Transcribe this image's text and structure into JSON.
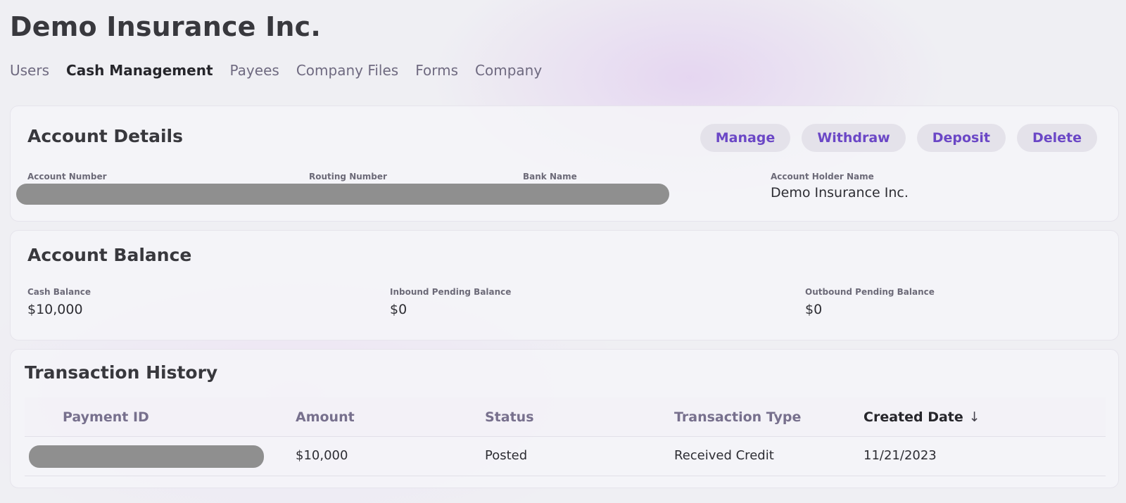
{
  "company": {
    "name": "Demo Insurance Inc."
  },
  "nav": {
    "tabs": [
      {
        "label": "Users"
      },
      {
        "label": "Cash Management"
      },
      {
        "label": "Payees"
      },
      {
        "label": "Company Files"
      },
      {
        "label": "Forms"
      },
      {
        "label": "Company"
      }
    ],
    "active": "Cash Management"
  },
  "account_details": {
    "title": "Account Details",
    "actions": {
      "manage": "Manage",
      "withdraw": "Withdraw",
      "deposit": "Deposit",
      "delete": "Delete"
    },
    "fields": {
      "account_number_label": "Account Number",
      "routing_number_label": "Routing Number",
      "bank_name_label": "Bank Name",
      "holder_name_label": "Account Holder Name",
      "holder_name_value": "Demo Insurance Inc."
    }
  },
  "account_balance": {
    "title": "Account Balance",
    "cash_label": "Cash Balance",
    "cash_value": "$10,000",
    "inbound_label": "Inbound Pending Balance",
    "inbound_value": "$0",
    "outbound_label": "Outbound Pending Balance",
    "outbound_value": "$0"
  },
  "transaction_history": {
    "title": "Transaction History",
    "columns": {
      "payment_id": "Payment ID",
      "amount": "Amount",
      "status": "Status",
      "transaction_type": "Transaction Type",
      "created_date": "Created Date"
    },
    "sort_icon": "arrow-down-icon",
    "rows": [
      {
        "amount": "$10,000",
        "status": "Posted",
        "transaction_type": "Received Credit",
        "created_date": "11/21/2023"
      }
    ]
  },
  "colors": {
    "accent": "#6b47c6",
    "redaction": "#8f8f8f",
    "background": "#efeff3"
  }
}
